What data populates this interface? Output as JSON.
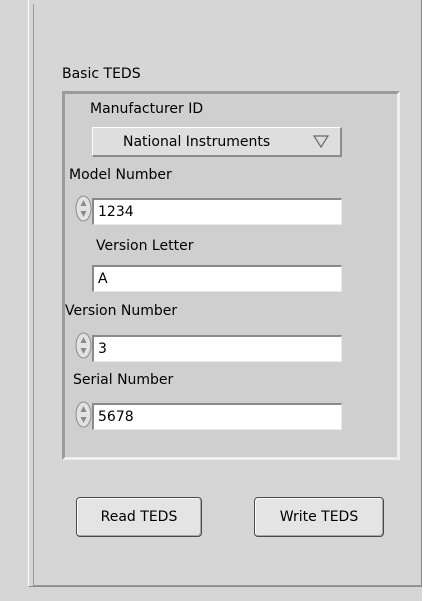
{
  "cluster": {
    "title": "Basic TEDS",
    "manufacturer_label": "Manufacturer ID",
    "manufacturer_value": "National Instruments",
    "model_label": "Model Number",
    "model_value": "1234",
    "version_letter_label": "Version Letter",
    "version_letter_value": "A",
    "version_number_label": "Version Number",
    "version_number_value": "3",
    "serial_label": "Serial Number",
    "serial_value": "5678"
  },
  "buttons": {
    "read": "Read TEDS",
    "write": "Write TEDS"
  }
}
